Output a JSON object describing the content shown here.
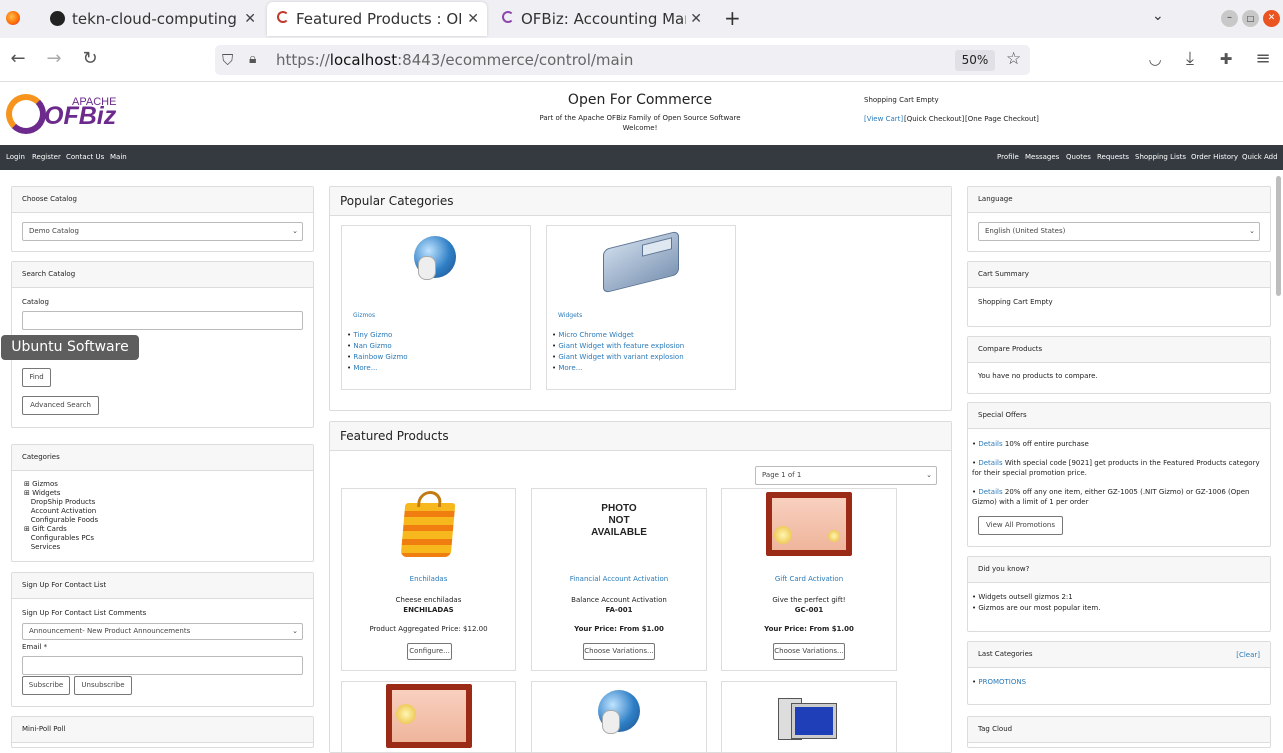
{
  "browser": {
    "tabs": [
      {
        "title": "tekn-cloud-computing/m"
      },
      {
        "title": "Featured Products : OFBiz"
      },
      {
        "title": "OFBiz: Accounting Manag"
      }
    ],
    "url_prefix": "https://",
    "url_host": "localhost",
    "url_rest": ":8443/ecommerce/control/main",
    "zoom": "50%"
  },
  "tooltip": "Ubuntu Software",
  "header": {
    "logo_top": "APACHE",
    "logo_main": "OFBiz",
    "title": "Open For Commerce",
    "subtitle": "Part of the Apache OFBiz Family of Open Source Software",
    "welcome": "Welcome!",
    "cart_status": "Shopping Cart Empty",
    "cart_links": [
      "[View Cart]",
      "[Quick Checkout]",
      "[One Page Checkout]"
    ]
  },
  "menu": {
    "left": [
      "Login",
      "Register",
      "Contact Us",
      "Main"
    ],
    "right": [
      "Profile",
      "Messages",
      "Quotes",
      "Requests",
      "Shopping Lists",
      "Order History",
      "Quick Add"
    ]
  },
  "left": {
    "choose_catalog": {
      "title": "Choose Catalog",
      "value": "Demo Catalog"
    },
    "search": {
      "title": "Search Catalog",
      "catalog_label": "Catalog",
      "find": "Find",
      "advanced": "Advanced Search"
    },
    "categories": {
      "title": "Categories",
      "items": [
        "Gizmos",
        "Widgets",
        "DropShip Products",
        "Account Activation",
        "Configurable Foods",
        "Gift Cards",
        "Configurables PCs",
        "Services"
      ]
    },
    "signup": {
      "title": "Sign Up For Contact List",
      "comments_label": "Sign Up For Contact List Comments",
      "list_value": "Announcement- New Product Announcements",
      "email_label": "Email *",
      "subscribe": "Subscribe",
      "unsubscribe": "Unsubscribe"
    },
    "poll": {
      "title": "Mini-Poll Poll"
    }
  },
  "center": {
    "popular_title": "Popular Categories",
    "popular": [
      {
        "name": "Gizmos",
        "items": [
          "Tiny Gizmo",
          "Nan Gizmo",
          "Rainbow Gizmo",
          "More..."
        ]
      },
      {
        "name": "Widgets",
        "items": [
          "Micro Chrome Widget",
          "Giant Widget with feature explosion",
          "Giant Widget with variant explosion",
          "More..."
        ]
      }
    ],
    "featured_title": "Featured Products",
    "pager": "Page 1 of 1",
    "products": [
      {
        "name": "Enchiladas",
        "desc": "Cheese enchiladas",
        "code": "ENCHILADAS",
        "price": "Product Aggregated Price: $12.00",
        "button": "Configure..."
      },
      {
        "name": "Financial Account Activation",
        "desc": "Balance Account Activation",
        "code": "FA-001",
        "price": "Your Price: From $1.00",
        "button": "Choose Variations...",
        "photo": [
          "PHOTO",
          "NOT",
          "AVAILABLE"
        ]
      },
      {
        "name": "Gift Card Activation",
        "desc": "Give the perfect gift!",
        "code": "GC-001",
        "price": "Your Price: From $1.00",
        "button": "Choose Variations..."
      }
    ]
  },
  "right": {
    "language": {
      "title": "Language",
      "value": "English (United States)"
    },
    "cart_summary": {
      "title": "Cart Summary",
      "text": "Shopping Cart Empty"
    },
    "compare": {
      "title": "Compare Products",
      "text": "You have no products to compare."
    },
    "offers": {
      "title": "Special Offers",
      "details": "Details",
      "items": [
        "10% off entire purchase",
        "With special code [9021] get products in the Featured Products category for their special promotion price.",
        "20% off any one item, either GZ-1005 (.NIT Gizmo) or GZ-1006 (Open Gizmo) with a limit of 1 per order"
      ],
      "view_all": "View All Promotions"
    },
    "did_you_know": {
      "title": "Did you know?",
      "items": [
        "Widgets outsell gizmos 2:1",
        "Gizmos are our most popular item."
      ]
    },
    "last_categories": {
      "title": "Last Categories",
      "clear": "[Clear]",
      "items": [
        "PROMOTIONS"
      ]
    },
    "tag_cloud": {
      "title": "Tag Cloud"
    }
  }
}
